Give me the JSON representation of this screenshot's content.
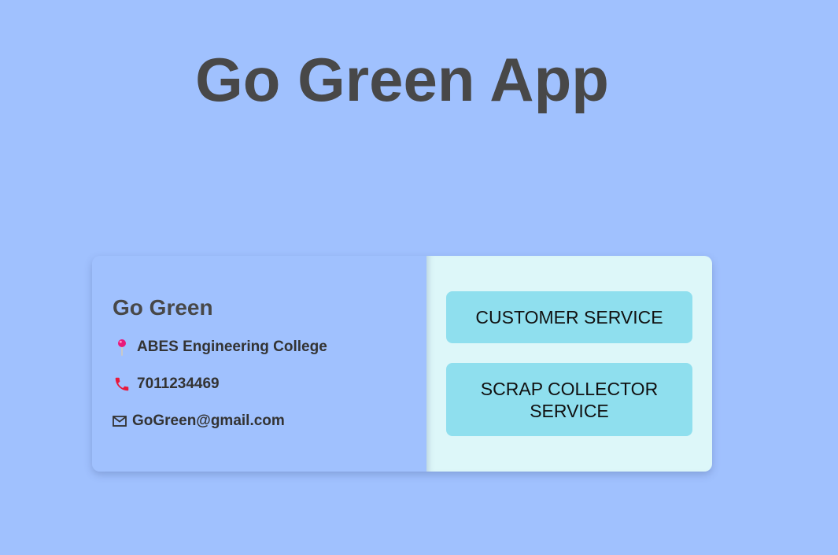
{
  "header": {
    "title": "Go Green App"
  },
  "card": {
    "brand_name": "Go Green",
    "location": {
      "icon": "location-pin-icon",
      "text": "ABES Engineering College"
    },
    "phone": {
      "icon": "phone-icon",
      "text": "7011234469"
    },
    "email": {
      "icon": "mail-icon",
      "text": "GoGreen@gmail.com"
    },
    "buttons": {
      "customer_service": "CUSTOMER SERVICE",
      "scrap_collector_service": "SCRAP COLLECTOR SERVICE"
    }
  },
  "colors": {
    "page_background": "#a0c1fe",
    "title_text": "#484848",
    "card_right_background": "#ddf7f9",
    "button_background": "#8fdfee",
    "pin_color": "#e8197a",
    "phone_color": "#e8193c"
  }
}
